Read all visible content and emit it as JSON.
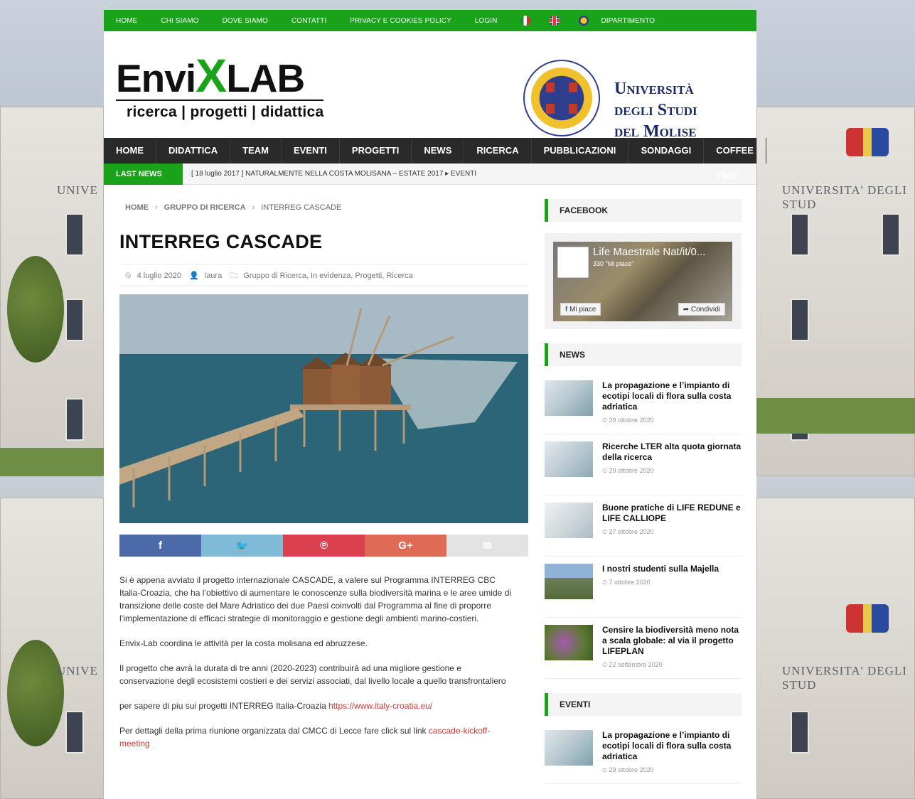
{
  "topbar": {
    "links": [
      "HOME",
      "CHI SIAMO",
      "DOVE SIAMO",
      "CONTATTI",
      "PRIVACY E COOKIES POLICY",
      "LOGIN"
    ],
    "flags": [
      "italian-flag-icon",
      "uk-flag-icon",
      "department-logo-icon"
    ],
    "dipartimento": "DIPARTIMENTO"
  },
  "header": {
    "logo_prefix": "Envi",
    "logo_x": "X",
    "logo_suffix": "LAB",
    "logo_sub": "ricerca | progetti | didattica",
    "university_line1": "Università",
    "university_line2": "degli Studi",
    "university_line3": "del Molise"
  },
  "nav": {
    "items": [
      "HOME",
      "DIDATTICA",
      "TEAM",
      "EVENTI",
      "PROGETTI",
      "NEWS",
      "RICERCA",
      "PUBBLICAZIONI",
      "SONDAGGI",
      "COFFEE TIME"
    ]
  },
  "ticker": {
    "label": "LAST NEWS",
    "text": "[ 18 luglio 2017 ]  NATURALMENTE NELLA COSTA MOLISANA – ESTATE 2017  ▸  EVENTI"
  },
  "breadcrumb": [
    "HOME",
    "GRUPPO DI RICERCA",
    "INTERREG CASCADE"
  ],
  "post": {
    "title": "INTERREG CASCADE",
    "date": "4 luglio 2020",
    "author": "laura",
    "categories": "Gruppo di Ricerca, In evidenza, Progetti, Ricerca",
    "paragraphs": [
      "Si è appena avviato il progetto internazionale CASCADE, a valere sul Programma INTERREG CBC Italia-Croazia, che ha l’obiettivo di aumentare le conoscenze sulla biodiversità marina e le aree umide di transizione delle coste del Mare Adriatico dei due Paesi coinvolti dal Programma al fine di proporre l’implementazione di efficaci strategie di monitoraggio e gestione degli ambienti marino-costieri.",
      "Envix-Lab coordina le attività per la costa molisana ed abruzzese.",
      "Il progetto che avrà la durata di tre anni (2020-2023) contribuirà ad una migliore gestione e conservazione degli ecosistemi costieri e dei servizi associati, dal livello locale a quello transfrontaliero"
    ],
    "link_intro": "per sapere di piu sui progetti INTERREG Italia-Croazia ",
    "link_url": "https://www.italy-croatia.eu/",
    "kickoff_intro": "Per dettagli della prima riunione organizzata dal CMCC di Lecce fare click sul link ",
    "kickoff_link": " cascade-kickoff-meeting"
  },
  "share": {
    "icons": [
      "facebook-icon",
      "twitter-icon",
      "pinterest-icon",
      "google-plus-icon",
      "email-icon"
    ],
    "labels": [
      "f",
      "🐦",
      "℗",
      "G+",
      "✉"
    ]
  },
  "sidebar": {
    "facebook_title": "FACEBOOK",
    "fb_page_name": "Life Maestrale Nat/it/0...",
    "fb_likes": "330 \"Mi piace\"",
    "fb_like_btn": "Mi piace",
    "fb_share_btn": "Condividi",
    "news_title": "NEWS",
    "news": [
      {
        "title": "La propagazione e l’impianto di ecotipi locali di flora sulla costa adriatica",
        "date": "29 ottobre 2020"
      },
      {
        "title": "Ricerche LTER alta quota giornata della ricerca",
        "date": "29 ottobre 2020"
      },
      {
        "title": "Buone pratiche di LIFE REDUNE e LIFE CALLIOPE",
        "date": "27 ottobre 2020"
      },
      {
        "title": "I nostri studenti sulla Majella",
        "date": "7 ottobre 2020"
      },
      {
        "title": "Censire la biodiversità meno nota a scala globale: al via il progetto LIFEPLAN",
        "date": "22 settembre 2020"
      }
    ],
    "eventi_title": "EVENTI",
    "eventi": [
      {
        "title": "La propagazione e l’impianto di ecotipi locali di flora sulla costa adriatica",
        "date": "29 ottobre 2020"
      }
    ]
  },
  "background": {
    "sign_left": "UNIVE",
    "sign_right": "UNIVERSITA' DEGLI STUD"
  }
}
